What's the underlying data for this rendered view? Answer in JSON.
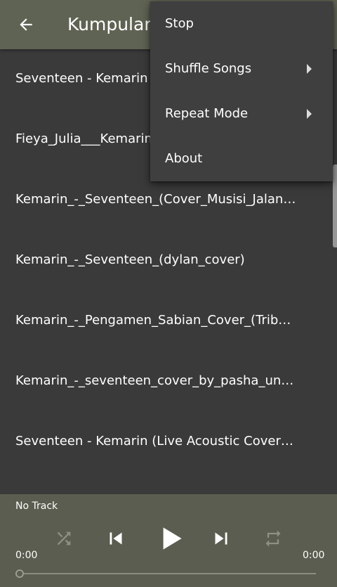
{
  "appbar": {
    "title": "Kumpulan",
    "back_icon": "arrow-left-icon"
  },
  "songs": [
    {
      "title": "Seventeen - Kemarin (L"
    },
    {
      "title": "Fieya_Julia___Kemarin"
    },
    {
      "title": "Kemarin_-_Seventeen_(Cover_Musisi_Jalana…"
    },
    {
      "title": "Kemarin_-_Seventeen_(dylan_cover)"
    },
    {
      "title": "Kemarin_-_Pengamen_Sabian_Cover_(Tribut…"
    },
    {
      "title": "Kemarin_-_seventeen_cover_by_pasha_ungu"
    },
    {
      "title": "Seventeen - Kemarin (Live Acoustic Cover by…"
    }
  ],
  "menu": {
    "items": [
      {
        "label": "Stop",
        "has_submenu": false
      },
      {
        "label": "Shuffle Songs",
        "has_submenu": true
      },
      {
        "label": "Repeat Mode",
        "has_submenu": true
      },
      {
        "label": "About",
        "has_submenu": false
      }
    ]
  },
  "player": {
    "now_playing": "No Track",
    "current_time": "0:00",
    "total_time": "0:00",
    "progress": 0,
    "controls": [
      "shuffle-icon",
      "previous-icon",
      "play-icon",
      "next-icon",
      "repeat-icon"
    ]
  },
  "colors": {
    "appbar": "#5f6353",
    "background": "#3a3a3a",
    "menu": "#3f3f3f",
    "player": "#5a5d4f",
    "disabled_icon": "#8e9082"
  }
}
